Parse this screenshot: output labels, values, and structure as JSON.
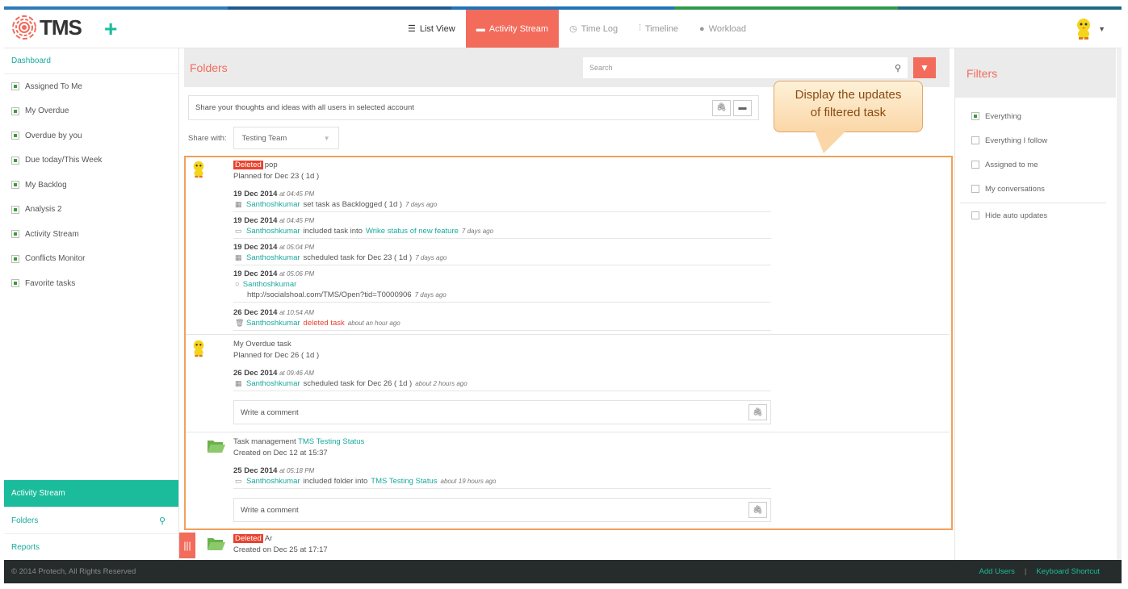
{
  "colors": {
    "accent": "#f36b5b",
    "teal": "#1abc9c",
    "stripe": [
      "#2d7bb8",
      "#1e5a8f",
      "#1f73b7",
      "#2b9a4a",
      "#1f6a80"
    ]
  },
  "app": {
    "logo_text": "TMS",
    "add_icon": "plus-icon"
  },
  "tabs": [
    {
      "label": "List View",
      "icon": "list-icon",
      "glyph": "☰"
    },
    {
      "label": "Activity Stream",
      "icon": "comment-icon",
      "glyph": "▬"
    },
    {
      "label": "Time Log",
      "icon": "clock-icon",
      "glyph": "◷"
    },
    {
      "label": "Timeline",
      "icon": "timeline-icon",
      "glyph": "⫶"
    },
    {
      "label": "Workload",
      "icon": "user-icon",
      "glyph": "👤"
    }
  ],
  "sidebar": {
    "dashboard": "Dashboard",
    "items": [
      {
        "label": "Assigned To Me"
      },
      {
        "label": "My Overdue"
      },
      {
        "label": "Overdue by you"
      },
      {
        "label": "Due today/This Week"
      },
      {
        "label": "My Backlog"
      },
      {
        "label": "Analysis 2"
      },
      {
        "label": "Activity Stream"
      },
      {
        "label": "Conflicts Monitor"
      },
      {
        "label": "Favorite tasks"
      }
    ],
    "bottom": {
      "activity": "Activity Stream",
      "folders": "Folders",
      "reports": "Reports"
    }
  },
  "main": {
    "title": "Folders",
    "search_placeholder": "Search",
    "share_placeholder": "Share your thoughts and ideas with all users in selected account",
    "share_with_label": "Share with:",
    "share_with_value": "Testing Team",
    "callout_line1": "Display the updates",
    "callout_line2": "of filtered task",
    "comment_placeholder": "Write a comment"
  },
  "feed": {
    "entry1": {
      "badge": "Deleted",
      "title": "pop",
      "planned": "Planned for Dec 23 ( 1d )",
      "acts": [
        {
          "date": "19 Dec 2014",
          "time": "at 04:45 PM",
          "user": "Santhoshkumar",
          "text": "set task as Backlogged ( 1d )",
          "link": "",
          "ago": "7 days ago"
        },
        {
          "date": "19 Dec 2014",
          "time": "at 04:45 PM",
          "user": "Santhoshkumar",
          "text": "included task into",
          "link": "Wrike status of new feature",
          "ago": "7 days ago"
        },
        {
          "date": "19 Dec 2014",
          "time": "at 05:04 PM",
          "user": "Santhoshkumar",
          "text": "scheduled task for Dec 23 ( 1d )",
          "link": "",
          "ago": "7 days ago"
        },
        {
          "date": "19 Dec 2014",
          "time": "at 05:06 PM",
          "user": "Santhoshkumar",
          "text": "http://socialshoal.com/TMS/Open?tid=T0000906",
          "link": "",
          "ago": "7 days ago"
        },
        {
          "date": "26 Dec 2014",
          "time": "at 10:54 AM",
          "user": "Santhoshkumar",
          "text": "deleted task",
          "link": "",
          "ago": "about an hour ago"
        }
      ]
    },
    "entry2": {
      "title": "My Overdue task",
      "planned": "Planned for Dec 26 ( 1d )",
      "act": {
        "date": "26 Dec 2014",
        "time": "at 09:46 AM",
        "user": "Santhoshkumar",
        "text": "scheduled task for Dec 26 ( 1d )",
        "ago": "about 2 hours ago"
      }
    },
    "entry3": {
      "title": "Task management",
      "title_link": "TMS Testing Status",
      "created": "Created on Dec 12 at 15:37",
      "act": {
        "date": "25 Dec 2014",
        "time": "at 05:18 PM",
        "user": "Santhoshkumar",
        "text": "included folder into",
        "link": "TMS Testing Status",
        "ago": "about 19 hours ago"
      }
    },
    "entry4": {
      "badge": "Deleted",
      "title": "Ar",
      "created": "Created on Dec 25 at 17:17"
    }
  },
  "filters": {
    "title": "Filters",
    "items": [
      {
        "label": "Everything",
        "checked": true
      },
      {
        "label": "Everything I follow",
        "checked": false
      },
      {
        "label": "Assigned to me",
        "checked": false
      },
      {
        "label": "My conversations",
        "checked": false
      }
    ],
    "hide_auto": "Hide auto updates"
  },
  "footer": {
    "copyright": "© 2014 Protech, All Rights Reserved",
    "add_users": "Add Users",
    "separator": "|",
    "keyboard": "Keyboard Shortcut"
  }
}
